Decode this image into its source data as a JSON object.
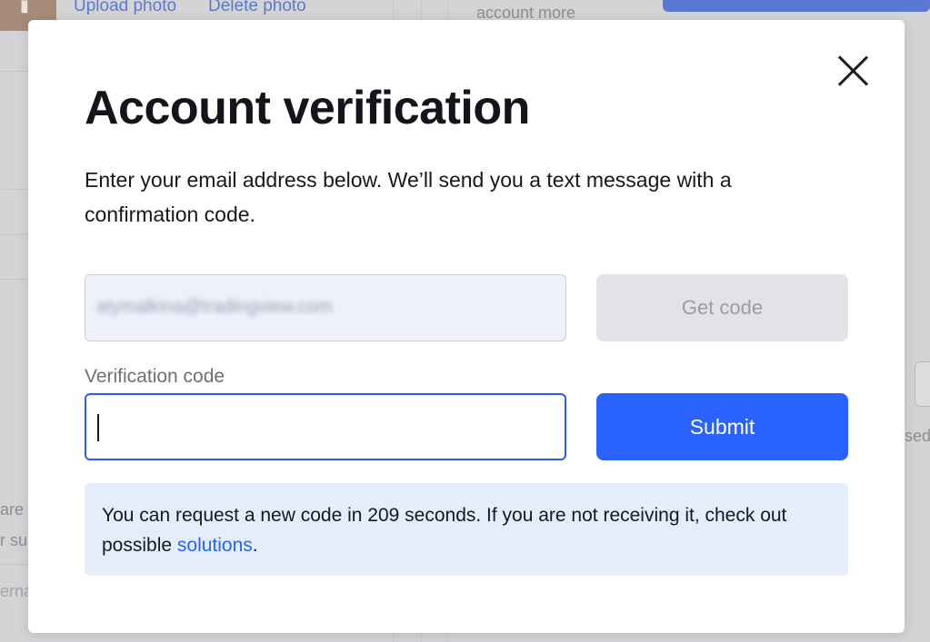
{
  "background": {
    "upload_photo": "Upload photo",
    "delete_photo": "Delete photo",
    "account_more": "account more",
    "frag_are": "are",
    "frag_su": "r su",
    "frag_erna": "erna",
    "frag_sed": "sed"
  },
  "modal": {
    "title": "Account verification",
    "description": "Enter your email address below. We’ll send you a text message with a confirmation code.",
    "email_value": "atymalkina@tradingview.com",
    "get_code_label": "Get code",
    "verification_label": "Verification code",
    "verification_value": "",
    "submit_label": "Submit",
    "notice_before_count": "You can request a new code in ",
    "countdown_seconds": "209",
    "notice_after_count": " seconds. If you are not receiving it, check out possible ",
    "solutions_link": "solutions",
    "notice_end": "."
  },
  "icons": {
    "close": "close-icon"
  },
  "colors": {
    "accent": "#2962ff",
    "notice_bg": "#e3edfb",
    "disabled_btn": "#e2e3e9"
  }
}
